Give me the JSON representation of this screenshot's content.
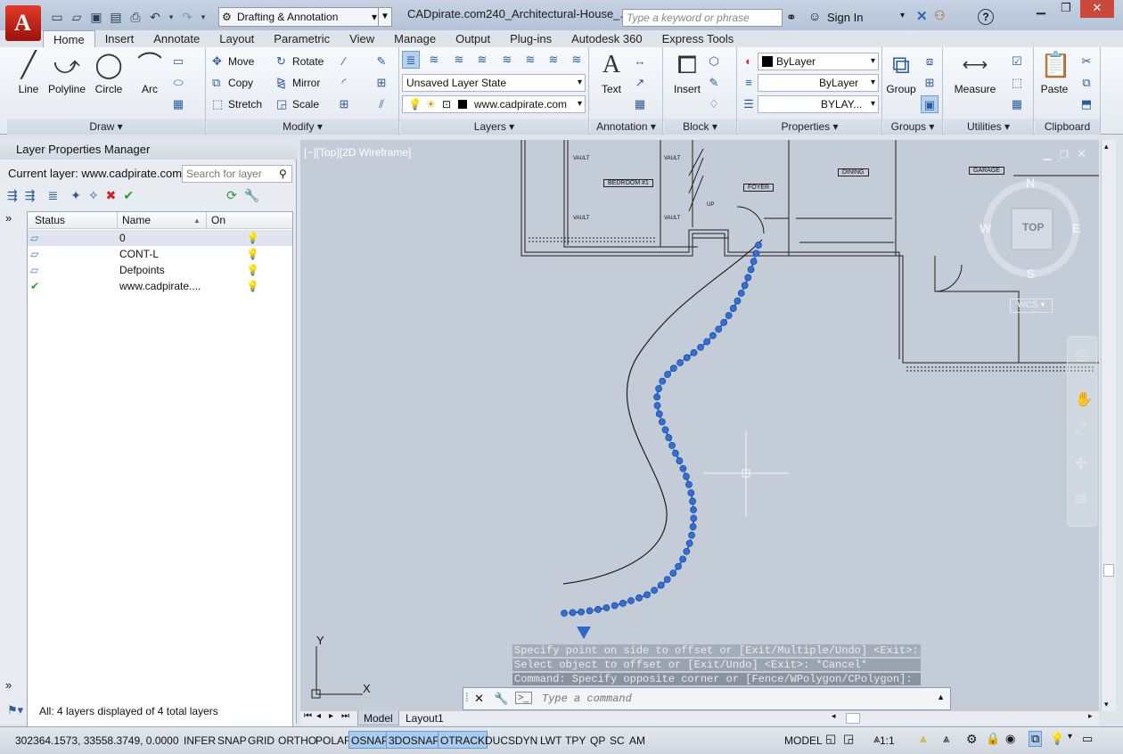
{
  "title": {
    "workspace": "Drafting & Annotation",
    "document": "CADpirate.com240_Architectural-House_...",
    "search_placeholder": "Type a keyword or phrase",
    "sign_in": "Sign In"
  },
  "tabs": [
    "Home",
    "Insert",
    "Annotate",
    "Layout",
    "Parametric",
    "View",
    "Manage",
    "Output",
    "Plug-ins",
    "Autodesk 360",
    "Express Tools"
  ],
  "ribbon": {
    "draw": {
      "title": "Draw",
      "line": "Line",
      "polyline": "Polyline",
      "circle": "Circle",
      "arc": "Arc"
    },
    "modify": {
      "title": "Modify",
      "move": "Move",
      "rotate": "Rotate",
      "copy": "Copy",
      "mirror": "Mirror",
      "stretch": "Stretch",
      "scale": "Scale"
    },
    "layers": {
      "title": "Layers",
      "state": "Unsaved Layer State",
      "current": "www.cadpirate.com"
    },
    "annotation": {
      "title": "Annotation",
      "text": "Text"
    },
    "block": {
      "title": "Block",
      "insert": "Insert"
    },
    "properties": {
      "title": "Properties",
      "color": "ByLayer",
      "linetype": "ByLayer",
      "lineweight": "BYLAY..."
    },
    "groups": {
      "title": "Groups",
      "group": "Group"
    },
    "utilities": {
      "title": "Utilities",
      "measure": "Measure"
    },
    "clipboard": {
      "title": "Clipboard",
      "paste": "Paste"
    }
  },
  "layer_panel": {
    "title": "Layer Properties Manager",
    "current_layer": "Current layer: www.cadpirate.com",
    "search_placeholder": "Search for layer",
    "columns": {
      "status": "Status",
      "name": "Name",
      "on": "On"
    },
    "layers": [
      {
        "name": "0"
      },
      {
        "name": "CONT-L"
      },
      {
        "name": "Defpoints"
      },
      {
        "name": "www.cadpirate...."
      }
    ],
    "footer": "All: 4 layers displayed of 4 total layers"
  },
  "viewport": {
    "label": "[−][Top][2D Wireframe]",
    "viewcube": {
      "top": "TOP",
      "n": "N",
      "s": "S",
      "e": "E",
      "w": "W",
      "wcs": "WCS"
    },
    "ucs": {
      "x": "X",
      "y": "Y"
    },
    "rooms": [
      "BEDROOM #1",
      "FOYER",
      "DINING",
      "GARAGE",
      "VAULT",
      "VAULT",
      "VAULT",
      "VAULT",
      "UP"
    ]
  },
  "command": {
    "history": [
      "Specify point on side to offset or [Exit/Multiple/Undo] <Exit>:",
      "Select object to offset or [Exit/Undo] <Exit>: *Cancel*",
      "Command: Specify opposite corner or [Fence/WPolygon/CPolygon]:"
    ],
    "placeholder": "Type a command"
  },
  "layout_tabs": {
    "model": "Model",
    "layout1": "Layout1"
  },
  "status": {
    "coords": "302364.1573, 33558.3749, 0.0000",
    "toggles": [
      {
        "label": "INFER",
        "on": false
      },
      {
        "label": "SNAP",
        "on": false
      },
      {
        "label": "GRID",
        "on": false
      },
      {
        "label": "ORTHO",
        "on": false
      },
      {
        "label": "POLAR",
        "on": false
      },
      {
        "label": "OSNAP",
        "on": true
      },
      {
        "label": "3DOSNAP",
        "on": true
      },
      {
        "label": "OTRACK",
        "on": true
      },
      {
        "label": "DUCS",
        "on": false
      },
      {
        "label": "DYN",
        "on": false
      },
      {
        "label": "LWT",
        "on": false
      },
      {
        "label": "TPY",
        "on": false
      },
      {
        "label": "QP",
        "on": false
      },
      {
        "label": "SC",
        "on": false
      },
      {
        "label": "AM",
        "on": false
      }
    ],
    "model": "MODEL",
    "scale": "1:1"
  }
}
